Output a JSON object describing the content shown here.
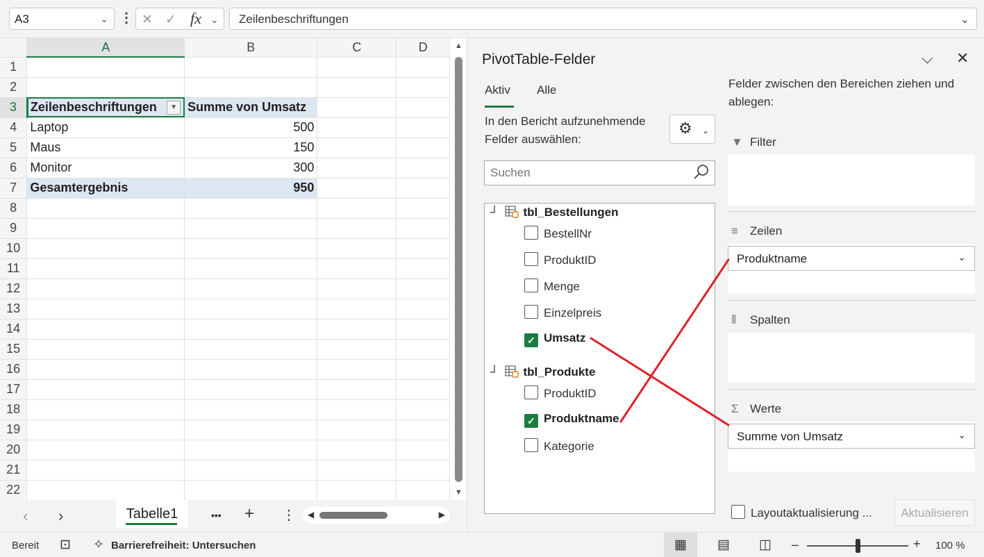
{
  "formula_bar": {
    "name_box": "A3",
    "formula": "Zeilenbeschriftungen",
    "fx_label": "fx"
  },
  "grid": {
    "columns": [
      "A",
      "B",
      "C",
      "D"
    ],
    "rows": [
      "1",
      "2",
      "3",
      "4",
      "5",
      "6",
      "7",
      "8",
      "9",
      "10",
      "11",
      "12",
      "13",
      "14",
      "15",
      "16",
      "17",
      "18",
      "19",
      "20",
      "21",
      "22"
    ],
    "pivot": {
      "header_a": "Zeilenbeschriftungen",
      "header_b": "Summe von Umsatz",
      "items": [
        {
          "label": "Laptop",
          "value": "500"
        },
        {
          "label": "Maus",
          "value": "150"
        },
        {
          "label": "Monitor",
          "value": "300"
        }
      ],
      "total_label": "Gesamtergebnis",
      "total_value": "950"
    }
  },
  "sheet_tabs": {
    "active": "Tabelle1",
    "more": "•••",
    "add": "+",
    "options": "⋮"
  },
  "pivot_pane": {
    "title": "PivotTable-Felder",
    "tabs": [
      "Aktiv",
      "Alle"
    ],
    "fields_prompt": "In den Bericht aufzunehmende Felder auswählen:",
    "search_placeholder": "Suchen",
    "tables": [
      {
        "name": "tbl_Bestellungen",
        "fields": [
          {
            "name": "BestellNr",
            "checked": false
          },
          {
            "name": "ProduktID",
            "checked": false
          },
          {
            "name": "Menge",
            "checked": false
          },
          {
            "name": "Einzelpreis",
            "checked": false
          },
          {
            "name": "Umsatz",
            "checked": true
          }
        ]
      },
      {
        "name": "tbl_Produkte",
        "fields": [
          {
            "name": "ProduktID",
            "checked": false
          },
          {
            "name": "Produktname",
            "checked": true
          },
          {
            "name": "Kategorie",
            "checked": false
          }
        ]
      }
    ],
    "areas_prompt": "Felder zwischen den Bereichen ziehen und ablegen:",
    "areas": {
      "filter_label": "Filter",
      "rows_label": "Zeilen",
      "rows_field": "Produktname",
      "columns_label": "Spalten",
      "values_label": "Werte",
      "values_field": "Summe von Umsatz"
    },
    "defer_label": "Layoutaktualisierung ...",
    "update_button": "Aktualisieren"
  },
  "status_bar": {
    "ready": "Bereit",
    "accessibility": "Barrierefreiheit: Untersuchen",
    "zoom": "100 %",
    "zoom_minus": "–",
    "zoom_plus": "+"
  },
  "colors": {
    "accent": "#1c7c42",
    "pivot_header": "#dde7f1",
    "annotation": "#e0202a"
  },
  "zoom_level": 100
}
